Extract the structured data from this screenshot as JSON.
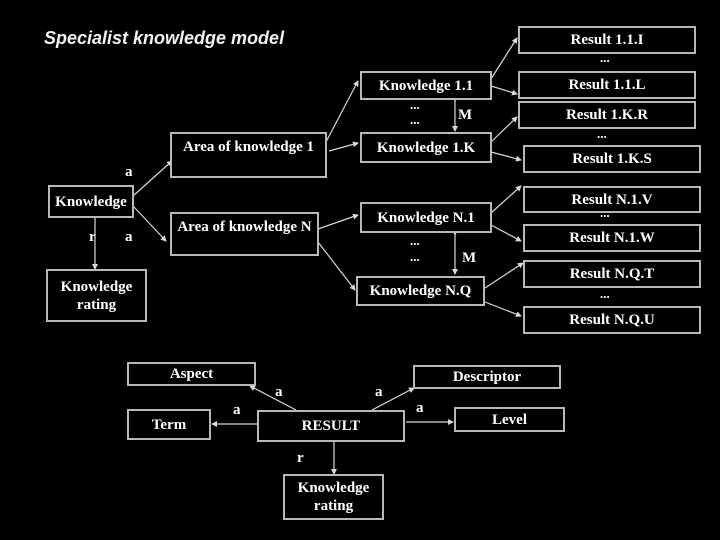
{
  "title": "Specialist knowledge model",
  "top_diagram": {
    "root": "Knowledge",
    "root_rating": [
      "Knowledge",
      "rating"
    ],
    "areas": [
      "Area of knowledge 1",
      "Area of knowledge N"
    ],
    "knowledge_items": [
      "Knowledge 1.1",
      "Knowledge 1.K",
      "Knowledge N.1",
      "Knowledge N.Q"
    ],
    "results": [
      "Result 1.1.I",
      "Result 1.1.L",
      "Result 1.K.R",
      "Result 1.K.S",
      "Result N.1.V",
      "Result N.1.W",
      "Result N.Q.T",
      "Result N.Q.U"
    ],
    "edge_labels": {
      "a": "a",
      "r": "r",
      "m": "M"
    },
    "ellipsis": "..."
  },
  "bottom_diagram": {
    "center": "RESULT",
    "aspect": "Aspect",
    "term": "Term",
    "descriptor": "Descriptor",
    "level": "Level",
    "rating": [
      "Knowledge",
      "rating"
    ],
    "edge_labels": {
      "a": "a",
      "r": "r"
    }
  }
}
